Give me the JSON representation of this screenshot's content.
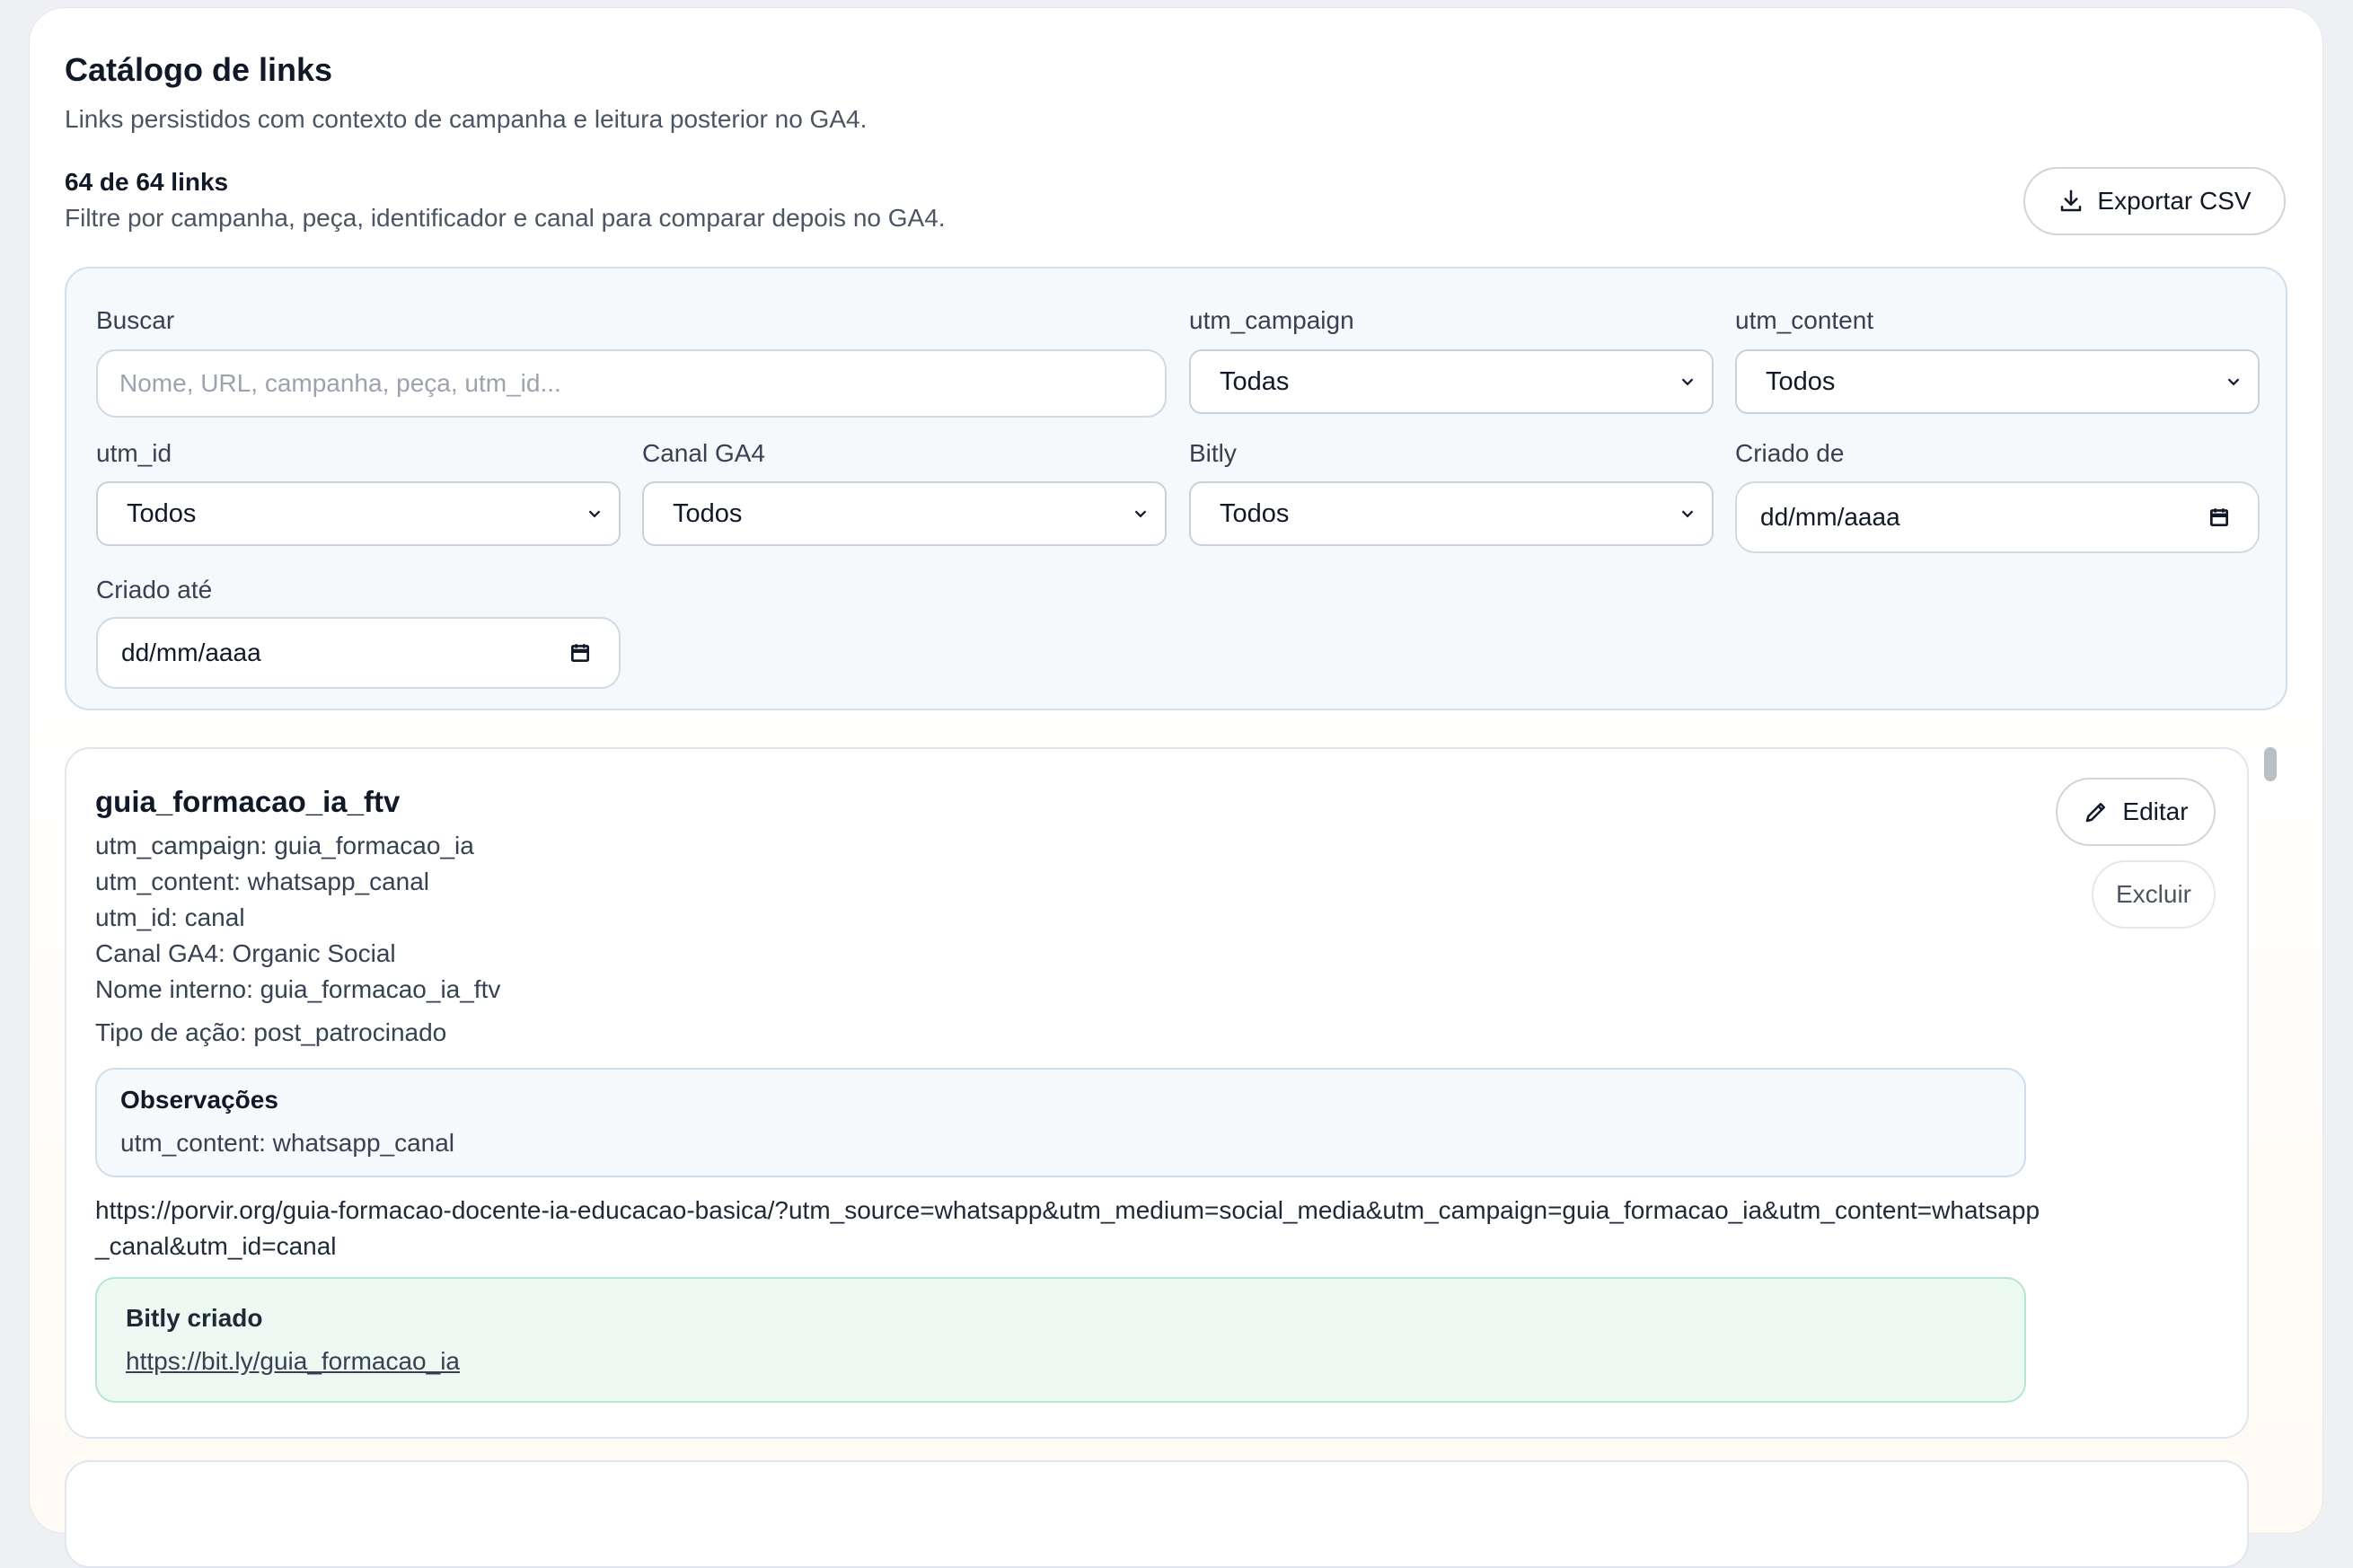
{
  "header": {
    "title": "Catálogo de links",
    "subtitle": "Links persistidos com contexto de campanha e leitura posterior no GA4.",
    "count": "64 de 64 links",
    "helper": "Filtre por campanha, peça, identificador e canal para comparar depois no GA4.",
    "export_label": "Exportar CSV"
  },
  "filters": {
    "search_label": "Buscar",
    "search_placeholder": "Nome, URL, campanha, peça, utm_id...",
    "campaign_label": "utm_campaign",
    "campaign_value": "Todas",
    "content_label": "utm_content",
    "content_value": "Todos",
    "utmid_label": "utm_id",
    "utmid_value": "Todos",
    "channel_label": "Canal GA4",
    "channel_value": "Todos",
    "bitly_label": "Bitly",
    "bitly_value": "Todos",
    "from_label": "Criado de",
    "from_value": "dd/mm/aaaa",
    "to_label": "Criado até",
    "to_value": "dd/mm/aaaa"
  },
  "card": {
    "title": "guia_formacao_ia_ftv",
    "campaign": "utm_campaign: guia_formacao_ia",
    "content": "utm_content: whatsapp_canal",
    "utm_id": "utm_id: canal",
    "channel": "Canal GA4: Organic Social",
    "internal_name": "Nome interno: guia_formacao_ia_ftv",
    "action_type": "Tipo de ação: post_patrocinado",
    "obs_title": "Observações",
    "obs_text": "utm_content: whatsapp_canal",
    "url": "https://porvir.org/guia-formacao-docente-ia-educacao-basica/?utm_source=whatsapp&utm_medium=social_media&utm_campaign=guia_formacao_ia&utm_content=whatsapp_canal&utm_id=canal",
    "bitly_title": "Bitly criado",
    "bitly_link": "https://bit.ly/guia_formacao_ia",
    "edit_label": "Editar",
    "delete_label": "Excluir"
  },
  "icons": {
    "export": "download-icon",
    "edit": "pencil-icon",
    "select": "chevron-down-icon",
    "date": "calendar-icon"
  }
}
